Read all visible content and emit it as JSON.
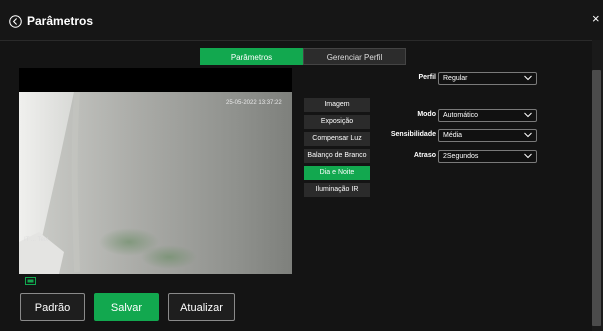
{
  "header": {
    "title": "Parâmetros",
    "back_icon": "chevron-left-circle-icon",
    "close_icon": "close-icon",
    "close_glyph": "×"
  },
  "tabs": [
    {
      "label": "Parâmetros",
      "active": true
    },
    {
      "label": "Gerenciar Perfil",
      "active": false
    }
  ],
  "video": {
    "timestamp": "25-05-2022 13:37:22",
    "camera_label": "IT ... Teix"
  },
  "menu": [
    {
      "label": "Imagem",
      "active": false
    },
    {
      "label": "Exposição",
      "active": false
    },
    {
      "label": "Compensar Luz",
      "active": false
    },
    {
      "label": "Balanço de Branco",
      "active": false
    },
    {
      "label": "Dia e Noite",
      "active": true
    },
    {
      "label": "Iluminação IR",
      "active": false
    }
  ],
  "fields": {
    "perfil": {
      "label": "Perfil",
      "value": "Regular"
    },
    "modo": {
      "label": "Modo",
      "value": "Automático"
    },
    "sensibilidade": {
      "label": "Sensibilidade",
      "value": "Média"
    },
    "atraso": {
      "label": "Atraso",
      "value": "2Segundos"
    }
  },
  "buttons": {
    "padrao": "Padrão",
    "salvar": "Salvar",
    "atualizar": "Atualizar"
  },
  "colors": {
    "accent": "#12a84f",
    "background": "#141414"
  }
}
